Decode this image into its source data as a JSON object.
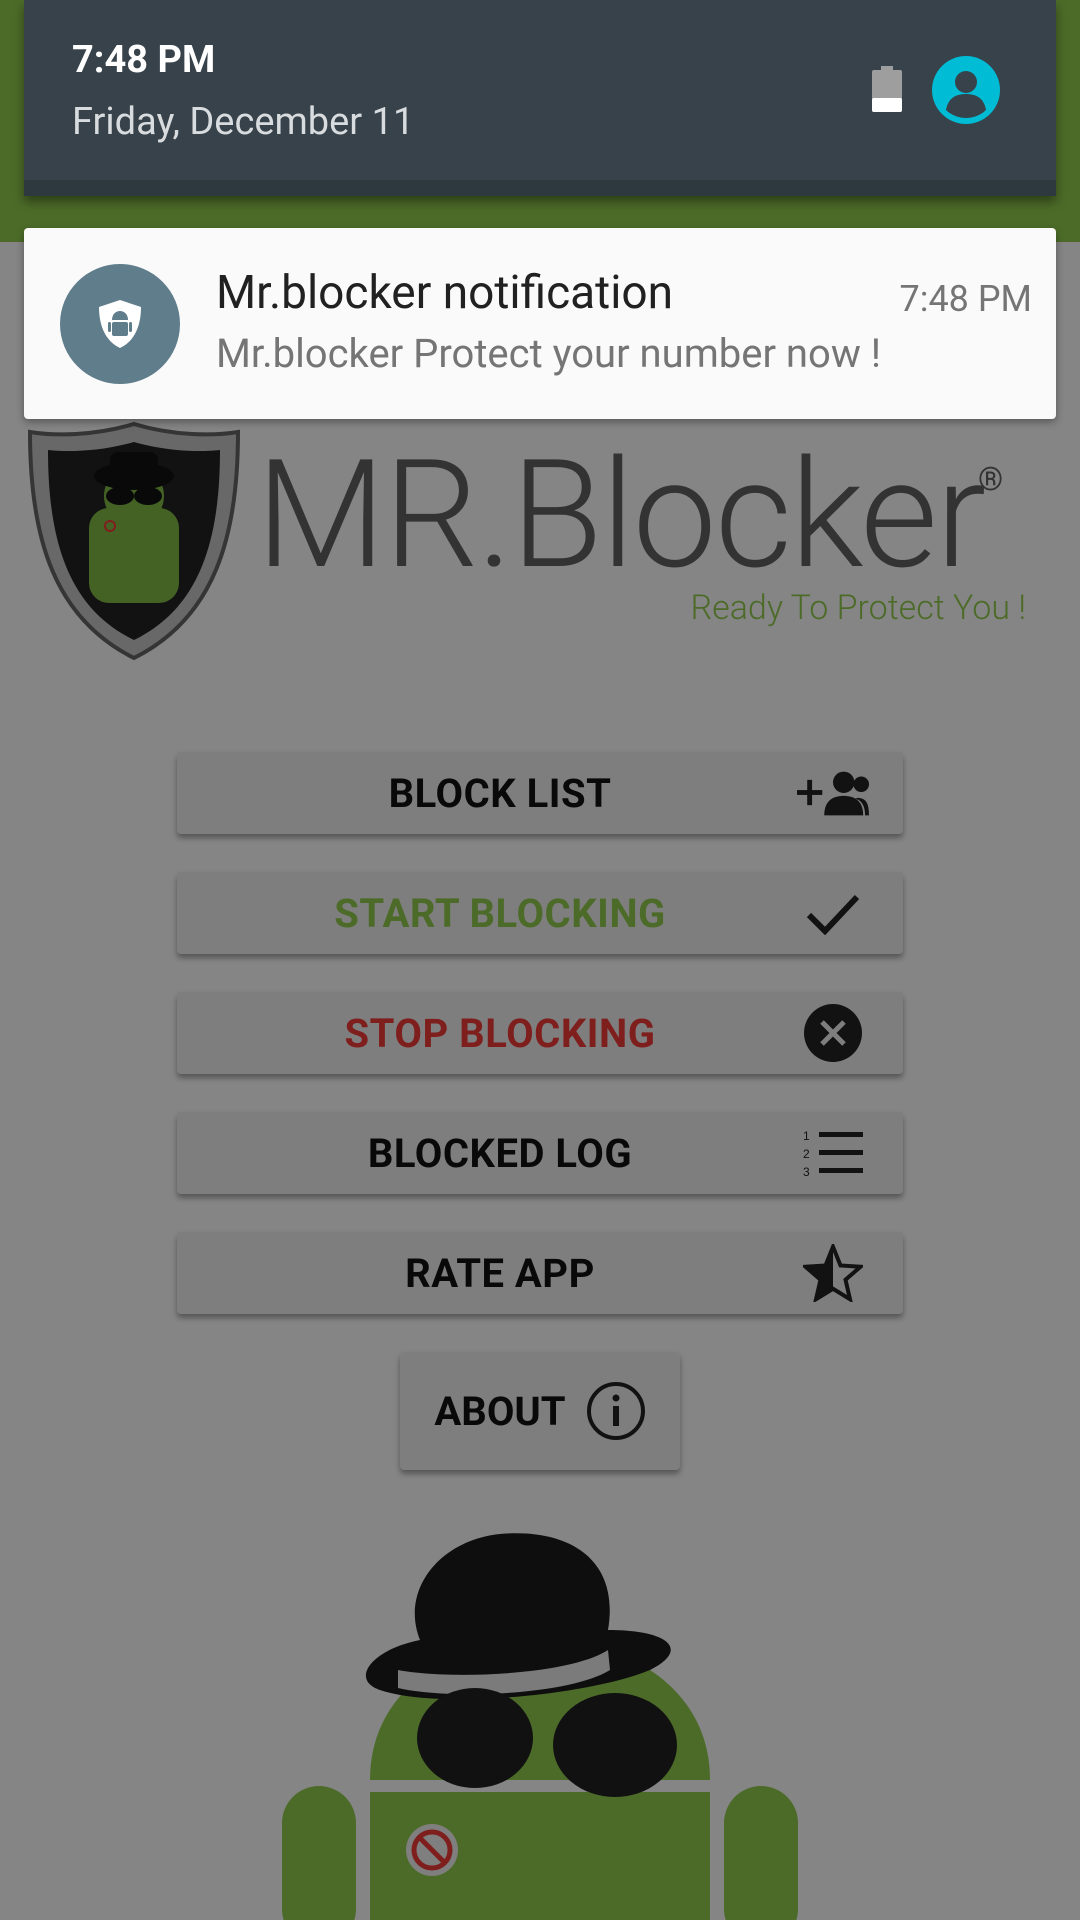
{
  "status_shade": {
    "time": "7:48 PM",
    "date": "Friday, December 11"
  },
  "notification": {
    "title": "Mr.blocker notification",
    "time": "7:48 PM",
    "text": "Mr.blocker Protect your number now !"
  },
  "app": {
    "logo_title": "MR.Blocker",
    "logo_reg": "®",
    "tagline": "Ready To Protect You !",
    "buttons": [
      {
        "label": "BLOCK LIST",
        "color": "#111111",
        "icon": "add-group-icon"
      },
      {
        "label": "START BLOCKING",
        "color": "#8bc34a",
        "icon": "checkmark-icon"
      },
      {
        "label": "STOP BLOCKING",
        "color": "#e53935",
        "icon": "close-circle-icon"
      },
      {
        "label": "BLOCKED LOG",
        "color": "#111111",
        "icon": "numbered-list-icon"
      },
      {
        "label": "RATE APP",
        "color": "#111111",
        "icon": "star-half-icon"
      }
    ],
    "about_label": "ABOUT",
    "accent_color": "#8bc34a"
  }
}
